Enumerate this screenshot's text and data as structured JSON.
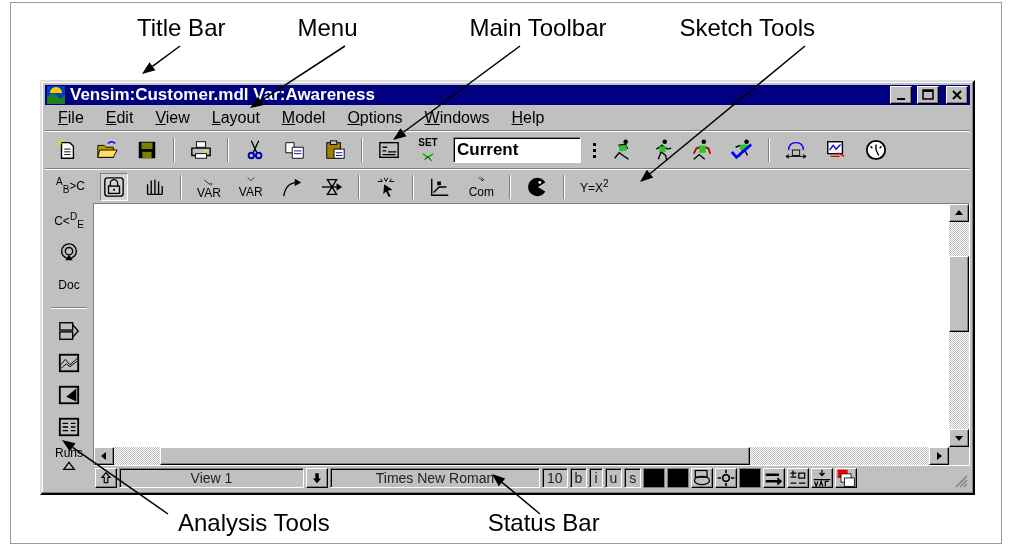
{
  "annotations": {
    "top": [
      "Title Bar",
      "Menu",
      "Main Toolbar",
      "Sketch Tools"
    ],
    "bottom": [
      "Analysis Tools",
      "Status Bar"
    ]
  },
  "window": {
    "title": "Vensim:Customer.mdl Var:Awareness"
  },
  "menu": [
    {
      "label": "File"
    },
    {
      "label": "Edit"
    },
    {
      "label": "View"
    },
    {
      "label": "Layout"
    },
    {
      "label": "Model"
    },
    {
      "label": "Options"
    },
    {
      "label": "Windows"
    },
    {
      "label": "Help"
    }
  ],
  "main_toolbar": [
    {
      "kind": "button"
    },
    {
      "kind": "button"
    },
    {
      "kind": "button"
    },
    {
      "kind": "separator"
    },
    {
      "kind": "button"
    },
    {
      "kind": "separator"
    },
    {
      "kind": "button"
    },
    {
      "kind": "button"
    },
    {
      "kind": "button"
    },
    {
      "kind": "separator"
    },
    {
      "kind": "button"
    },
    {
      "kind": "button",
      "label": "SET"
    },
    {
      "kind": "field",
      "value": "Current"
    },
    {
      "kind": "grip"
    },
    {
      "kind": "button"
    },
    {
      "kind": "button"
    },
    {
      "kind": "button"
    },
    {
      "kind": "button"
    },
    {
      "kind": "separator"
    },
    {
      "kind": "button"
    },
    {
      "kind": "button"
    },
    {
      "kind": "button"
    }
  ],
  "sketch_toolbar": [
    {
      "kind": "button",
      "label": "$^{A}$$_{B}$>C",
      "selected": false
    },
    {
      "kind": "button",
      "selected": true
    },
    {
      "kind": "button",
      "selected": false
    },
    {
      "kind": "separator"
    },
    {
      "kind": "button",
      "label": "VAR",
      "selected": false
    },
    {
      "kind": "button",
      "label": "VAR",
      "selected": false
    },
    {
      "kind": "button",
      "selected": false
    },
    {
      "kind": "button",
      "selected": false
    },
    {
      "kind": "separator"
    },
    {
      "kind": "button",
      "selected": false
    },
    {
      "kind": "separator"
    },
    {
      "kind": "button",
      "selected": false
    },
    {
      "kind": "button",
      "label": "Com",
      "selected": false
    },
    {
      "kind": "separator"
    },
    {
      "kind": "button",
      "selected": false
    },
    {
      "kind": "separator"
    },
    {
      "kind": "button",
      "label": "Y=X$^{2}$",
      "selected": false
    }
  ],
  "sidebar": [
    {
      "kind": "button",
      "label": "C<$^{D}$$_{E}$"
    },
    {
      "kind": "button"
    },
    {
      "kind": "button",
      "label": "Doc"
    },
    {
      "kind": "separator"
    },
    {
      "kind": "button"
    },
    {
      "kind": "button"
    },
    {
      "kind": "button"
    },
    {
      "kind": "button"
    },
    {
      "kind": "button",
      "label": "Runs"
    }
  ],
  "status_bar": [
    {
      "kind": "button"
    },
    {
      "kind": "field",
      "value": "View 1"
    },
    {
      "kind": "button"
    },
    {
      "kind": "field",
      "value": "Times New Roman"
    },
    {
      "kind": "text",
      "value": "10"
    },
    {
      "kind": "text",
      "value": "b"
    },
    {
      "kind": "text",
      "value": "i"
    },
    {
      "kind": "text",
      "value": "u"
    },
    {
      "kind": "text",
      "value": "s"
    },
    {
      "kind": "swatch",
      "color": "#000000"
    },
    {
      "kind": "swatch",
      "color": "#000000"
    },
    {
      "kind": "button"
    },
    {
      "kind": "button"
    },
    {
      "kind": "swatch",
      "color": "#000000"
    },
    {
      "kind": "button"
    },
    {
      "kind": "button"
    },
    {
      "kind": "button"
    },
    {
      "kind": "button"
    }
  ]
}
